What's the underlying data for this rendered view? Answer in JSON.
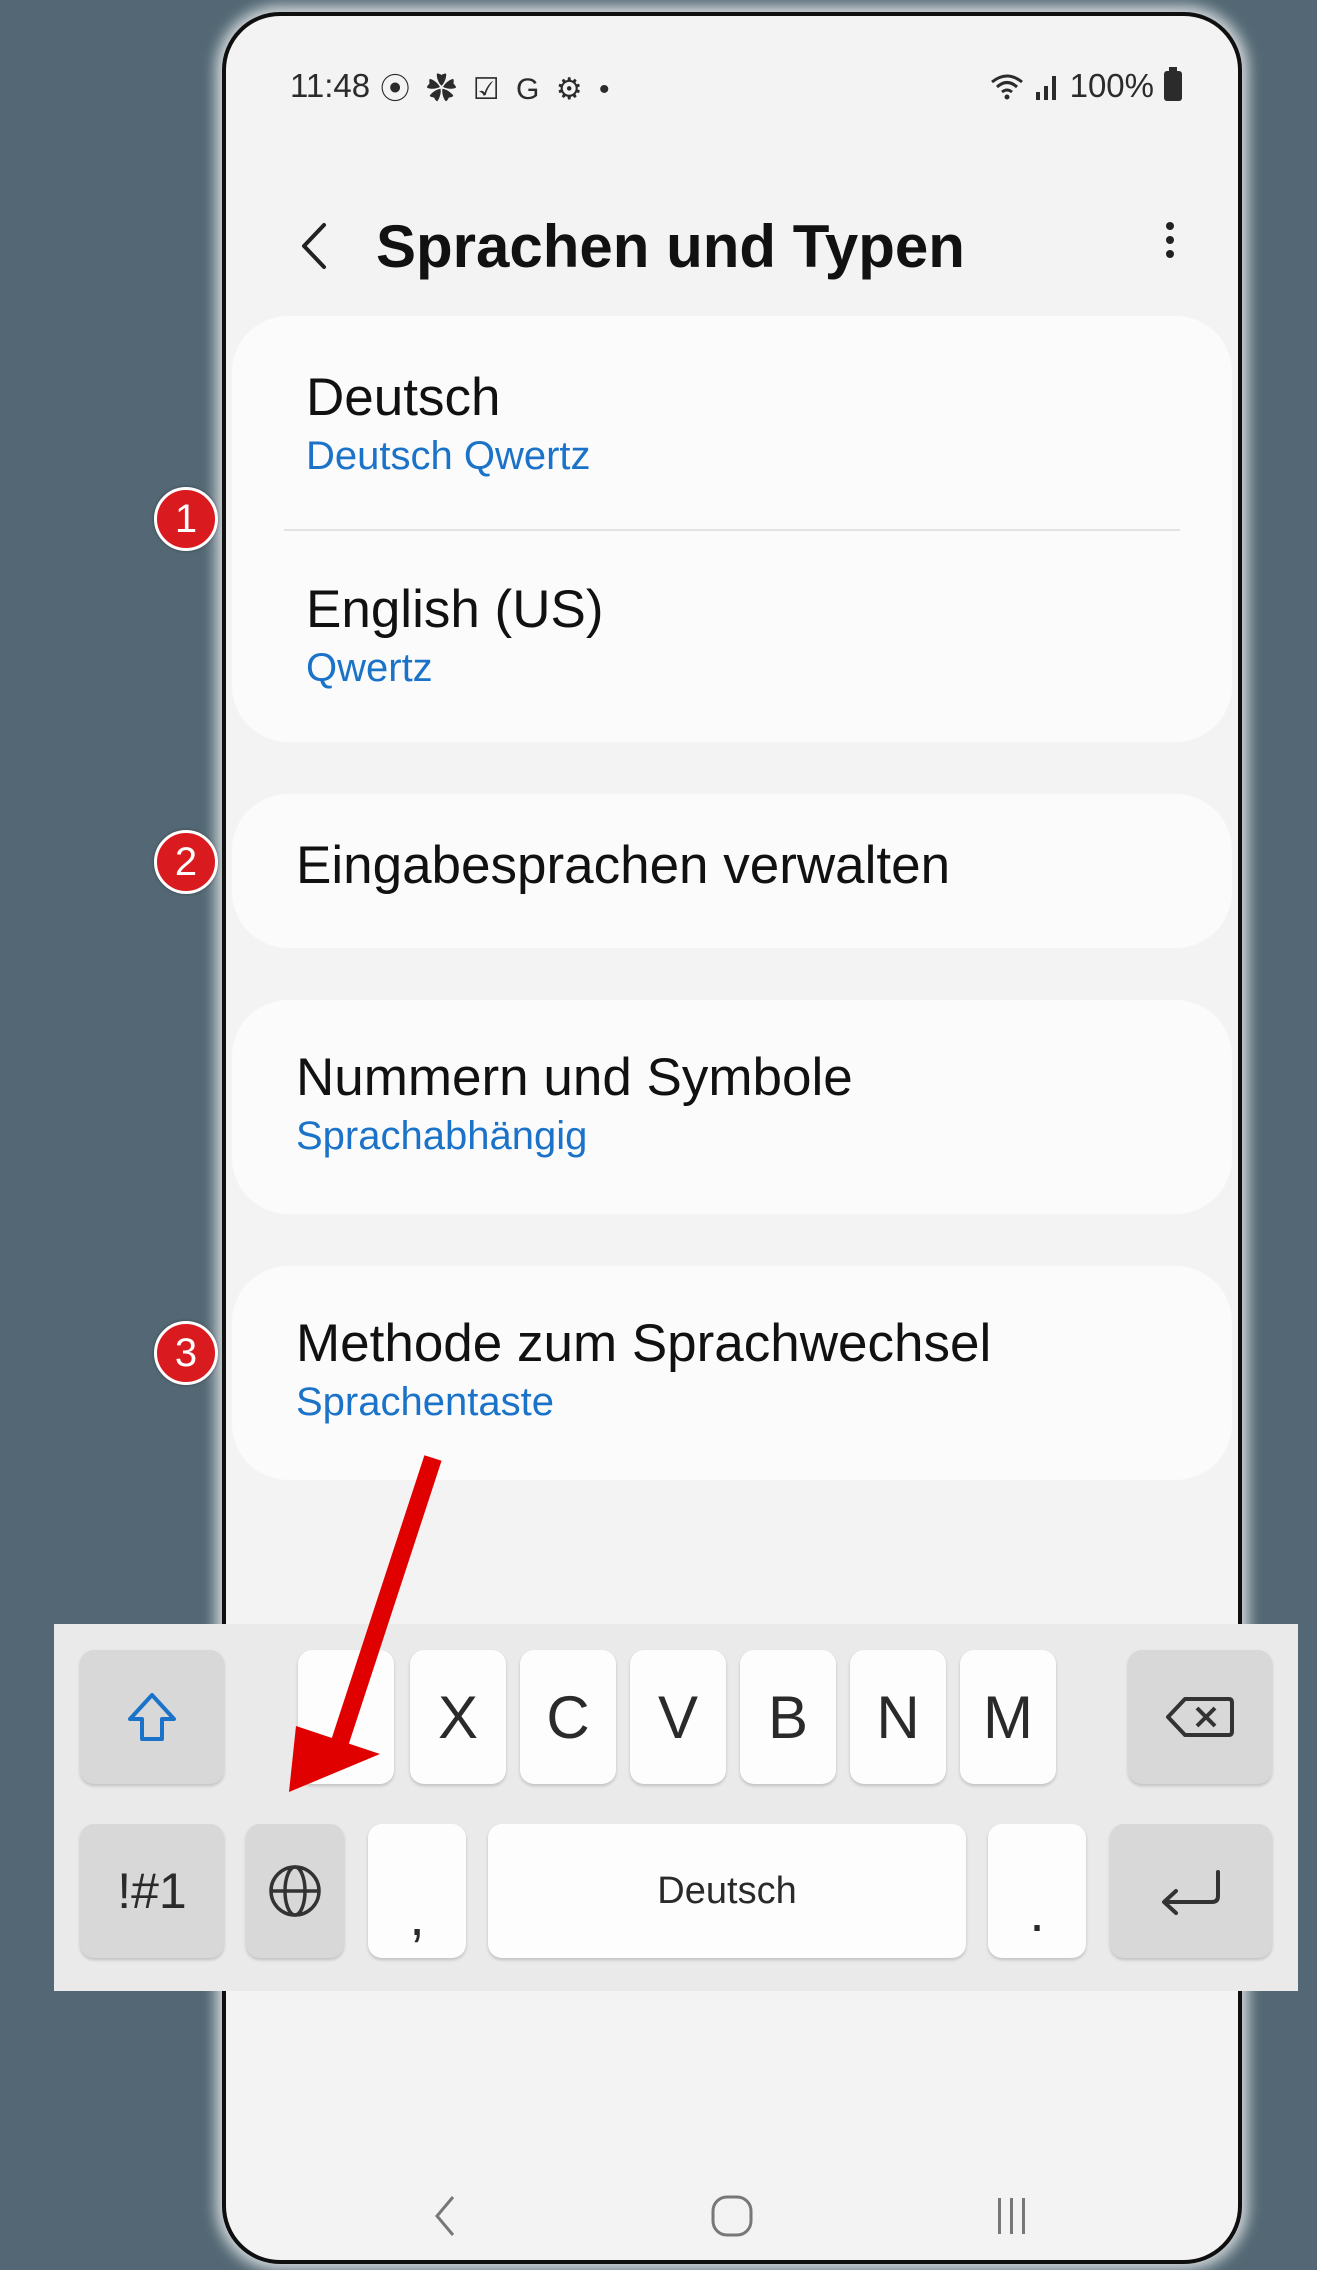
{
  "status_bar": {
    "time": "11:48",
    "notification_icons": "⦿ ✿ ☑ G ⚙ •",
    "battery": "100%"
  },
  "header": {
    "title": "Sprachen und Typen"
  },
  "languages": [
    {
      "name": "Deutsch",
      "layout": "Deutsch Qwertz"
    },
    {
      "name": "English (US)",
      "layout": "Qwertz"
    }
  ],
  "manage_languages": {
    "label": "Eingabesprachen verwalten"
  },
  "numbers_symbols": {
    "label": "Nummern und Symbole",
    "value": "Sprachabhängig"
  },
  "switch_method": {
    "label": "Methode zum Sprachwechsel",
    "value": "Sprachentaste"
  },
  "badges": [
    "1",
    "2",
    "3"
  ],
  "keyboard": {
    "row1_letters": [
      "X",
      "C",
      "V",
      "B",
      "N",
      "M"
    ],
    "symbols_key": "!#1",
    "comma": ",",
    "space_label": "Deutsch",
    "period": ".",
    "icons": {
      "shift": "shift-icon",
      "backspace": "backspace-icon",
      "globe": "globe-icon",
      "enter": "enter-icon"
    }
  },
  "colors": {
    "background": "#536874",
    "accent_blue": "#1b73c9",
    "badge_red": "#d91a1f",
    "arrow_red": "#e00000"
  }
}
